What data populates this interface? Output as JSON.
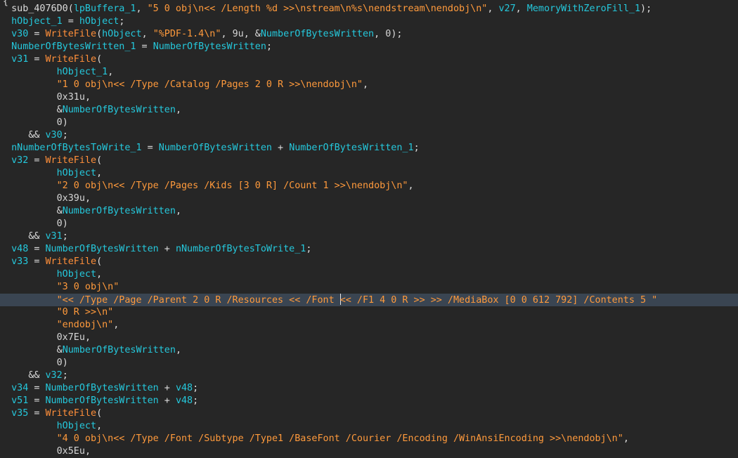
{
  "editor": {
    "top_fragment": "{",
    "current_line": 23,
    "caret_after_segment": 1,
    "lines": [
      {
        "indent": "  ",
        "tokens": [
          [
            "plain",
            "sub_4076D0("
          ],
          [
            "var",
            "lpBuffera_1"
          ],
          [
            "plain",
            ", "
          ],
          [
            "str",
            "\"5 0 obj\\n<< /Length %d >>\\nstream\\n%s\\nendstream\\nendobj\\n\""
          ],
          [
            "plain",
            ", "
          ],
          [
            "var",
            "v27"
          ],
          [
            "plain",
            ", "
          ],
          [
            "var",
            "MemoryWithZeroFill_1"
          ],
          [
            "plain",
            ");"
          ]
        ]
      },
      {
        "indent": "  ",
        "tokens": [
          [
            "var",
            "hObject_1"
          ],
          [
            "plain",
            " = "
          ],
          [
            "var",
            "hObject"
          ],
          [
            "plain",
            ";"
          ]
        ]
      },
      {
        "indent": "  ",
        "tokens": [
          [
            "var",
            "v30"
          ],
          [
            "plain",
            " = "
          ],
          [
            "fn",
            "WriteFile"
          ],
          [
            "plain",
            "("
          ],
          [
            "var",
            "hObject"
          ],
          [
            "plain",
            ", "
          ],
          [
            "str",
            "\"%PDF-1.4\\n\""
          ],
          [
            "plain",
            ", "
          ],
          [
            "num",
            "9u"
          ],
          [
            "plain",
            ", &"
          ],
          [
            "var",
            "NumberOfBytesWritten"
          ],
          [
            "plain",
            ", "
          ],
          [
            "num",
            "0"
          ],
          [
            "plain",
            ");"
          ]
        ]
      },
      {
        "indent": "  ",
        "tokens": [
          [
            "var",
            "NumberOfBytesWritten_1"
          ],
          [
            "plain",
            " = "
          ],
          [
            "var",
            "NumberOfBytesWritten"
          ],
          [
            "plain",
            ";"
          ]
        ]
      },
      {
        "indent": "  ",
        "tokens": [
          [
            "var",
            "v31"
          ],
          [
            "plain",
            " = "
          ],
          [
            "fn",
            "WriteFile"
          ],
          [
            "plain",
            "("
          ]
        ]
      },
      {
        "indent": "          ",
        "tokens": [
          [
            "var",
            "hObject_1"
          ],
          [
            "plain",
            ","
          ]
        ]
      },
      {
        "indent": "          ",
        "tokens": [
          [
            "str",
            "\"1 0 obj\\n<< /Type /Catalog /Pages 2 0 R >>\\nendobj\\n\""
          ],
          [
            "plain",
            ","
          ]
        ]
      },
      {
        "indent": "          ",
        "tokens": [
          [
            "num",
            "0x31u"
          ],
          [
            "plain",
            ","
          ]
        ]
      },
      {
        "indent": "          ",
        "tokens": [
          [
            "plain",
            "&"
          ],
          [
            "var",
            "NumberOfBytesWritten"
          ],
          [
            "plain",
            ","
          ]
        ]
      },
      {
        "indent": "          ",
        "tokens": [
          [
            "num",
            "0"
          ],
          [
            "plain",
            ")"
          ]
        ]
      },
      {
        "indent": "     ",
        "tokens": [
          [
            "plain",
            "&& "
          ],
          [
            "var",
            "v30"
          ],
          [
            "plain",
            ";"
          ]
        ]
      },
      {
        "indent": "  ",
        "tokens": [
          [
            "var",
            "nNumberOfBytesToWrite_1"
          ],
          [
            "plain",
            " = "
          ],
          [
            "var",
            "NumberOfBytesWritten"
          ],
          [
            "plain",
            " + "
          ],
          [
            "var",
            "NumberOfBytesWritten_1"
          ],
          [
            "plain",
            ";"
          ]
        ]
      },
      {
        "indent": "  ",
        "tokens": [
          [
            "var",
            "v32"
          ],
          [
            "plain",
            " = "
          ],
          [
            "fn",
            "WriteFile"
          ],
          [
            "plain",
            "("
          ]
        ]
      },
      {
        "indent": "          ",
        "tokens": [
          [
            "var",
            "hObject"
          ],
          [
            "plain",
            ","
          ]
        ]
      },
      {
        "indent": "          ",
        "tokens": [
          [
            "str",
            "\"2 0 obj\\n<< /Type /Pages /Kids [3 0 R] /Count 1 >>\\nendobj\\n\""
          ],
          [
            "plain",
            ","
          ]
        ]
      },
      {
        "indent": "          ",
        "tokens": [
          [
            "num",
            "0x39u"
          ],
          [
            "plain",
            ","
          ]
        ]
      },
      {
        "indent": "          ",
        "tokens": [
          [
            "plain",
            "&"
          ],
          [
            "var",
            "NumberOfBytesWritten"
          ],
          [
            "plain",
            ","
          ]
        ]
      },
      {
        "indent": "          ",
        "tokens": [
          [
            "num",
            "0"
          ],
          [
            "plain",
            ")"
          ]
        ]
      },
      {
        "indent": "     ",
        "tokens": [
          [
            "plain",
            "&& "
          ],
          [
            "var",
            "v31"
          ],
          [
            "plain",
            ";"
          ]
        ]
      },
      {
        "indent": "  ",
        "tokens": [
          [
            "var",
            "v48"
          ],
          [
            "plain",
            " = "
          ],
          [
            "var",
            "NumberOfBytesWritten"
          ],
          [
            "plain",
            " + "
          ],
          [
            "var",
            "nNumberOfBytesToWrite_1"
          ],
          [
            "plain",
            ";"
          ]
        ]
      },
      {
        "indent": "  ",
        "tokens": [
          [
            "var",
            "v33"
          ],
          [
            "plain",
            " = "
          ],
          [
            "fn",
            "WriteFile"
          ],
          [
            "plain",
            "("
          ]
        ]
      },
      {
        "indent": "          ",
        "tokens": [
          [
            "var",
            "hObject"
          ],
          [
            "plain",
            ","
          ]
        ]
      },
      {
        "indent": "          ",
        "tokens": [
          [
            "str",
            "\"3 0 obj\\n\""
          ]
        ]
      },
      {
        "indent": "          ",
        "tokens": [
          [
            "str",
            "\"<< /Type /Page /Parent 2 0 R /Resources << /Font "
          ],
          [
            "str",
            "<< /F1 4 0 R >> >> /MediaBox [0 0 612 792] /Contents 5 \""
          ]
        ]
      },
      {
        "indent": "          ",
        "tokens": [
          [
            "str",
            "\"0 R >>\\n\""
          ]
        ]
      },
      {
        "indent": "          ",
        "tokens": [
          [
            "str",
            "\"endobj\\n\""
          ],
          [
            "plain",
            ","
          ]
        ]
      },
      {
        "indent": "          ",
        "tokens": [
          [
            "num",
            "0x7Eu"
          ],
          [
            "plain",
            ","
          ]
        ]
      },
      {
        "indent": "          ",
        "tokens": [
          [
            "plain",
            "&"
          ],
          [
            "var",
            "NumberOfBytesWritten"
          ],
          [
            "plain",
            ","
          ]
        ]
      },
      {
        "indent": "          ",
        "tokens": [
          [
            "num",
            "0"
          ],
          [
            "plain",
            ")"
          ]
        ]
      },
      {
        "indent": "     ",
        "tokens": [
          [
            "plain",
            "&& "
          ],
          [
            "var",
            "v32"
          ],
          [
            "plain",
            ";"
          ]
        ]
      },
      {
        "indent": "  ",
        "tokens": [
          [
            "var",
            "v34"
          ],
          [
            "plain",
            " = "
          ],
          [
            "var",
            "NumberOfBytesWritten"
          ],
          [
            "plain",
            " + "
          ],
          [
            "var",
            "v48"
          ],
          [
            "plain",
            ";"
          ]
        ]
      },
      {
        "indent": "  ",
        "tokens": [
          [
            "var",
            "v51"
          ],
          [
            "plain",
            " = "
          ],
          [
            "var",
            "NumberOfBytesWritten"
          ],
          [
            "plain",
            " + "
          ],
          [
            "var",
            "v48"
          ],
          [
            "plain",
            ";"
          ]
        ]
      },
      {
        "indent": "  ",
        "tokens": [
          [
            "var",
            "v35"
          ],
          [
            "plain",
            " = "
          ],
          [
            "fn",
            "WriteFile"
          ],
          [
            "plain",
            "("
          ]
        ]
      },
      {
        "indent": "          ",
        "tokens": [
          [
            "var",
            "hObject"
          ],
          [
            "plain",
            ","
          ]
        ]
      },
      {
        "indent": "          ",
        "tokens": [
          [
            "str",
            "\"4 0 obj\\n<< /Type /Font /Subtype /Type1 /BaseFont /Courier /Encoding /WinAnsiEncoding >>\\nendobj\\n\""
          ],
          [
            "plain",
            ","
          ]
        ]
      },
      {
        "indent": "          ",
        "tokens": [
          [
            "num",
            "0x5Eu"
          ],
          [
            "plain",
            ","
          ]
        ]
      }
    ]
  },
  "colors": {
    "background": "#262626",
    "variable": "#25c8dc",
    "function": "#ff8f3a",
    "string": "#ff9a3c",
    "plain": "#dcdcdc",
    "current_line": "#3a4552"
  }
}
